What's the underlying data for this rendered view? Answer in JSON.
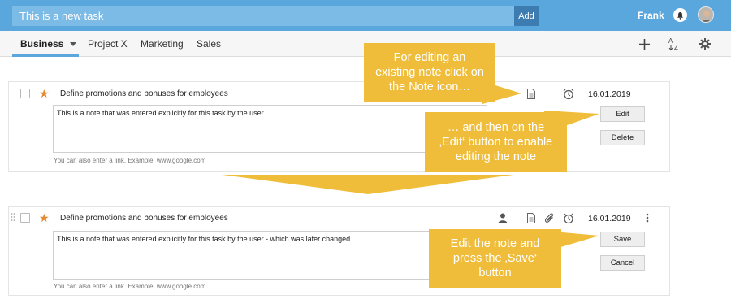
{
  "topbar": {
    "task_input_value": "This is a new task",
    "add_label": "Add",
    "user_name": "Frank"
  },
  "tabs": [
    {
      "label": "Business"
    },
    {
      "label": "Project X"
    },
    {
      "label": "Marketing"
    },
    {
      "label": "Sales"
    }
  ],
  "task_before": {
    "title": "Define promotions and bonuses for employees",
    "date": "16.01.2019",
    "note_text": "This is a note that was entered explicitly for this task by the user.",
    "hint": "You can also enter a link. Example: www.google.com",
    "edit_label": "Edit",
    "delete_label": "Delete"
  },
  "task_after": {
    "title": "Define promotions and bonuses for employees",
    "date": "16.01.2019",
    "note_text": "This is a note that was entered explicitly for this task by the user - which was later changed",
    "hint": "You can also enter a link. Example: www.google.com",
    "save_label": "Save",
    "cancel_label": "Cancel"
  },
  "callouts": {
    "note_icon": "For editing an\nexisting note click on\nthe Note icon…",
    "edit_button": "… and then on the\n‚Edit‘ button to enable\nediting the note",
    "save_button": "Edit the note and\npress the ‚Save‘\nbutton"
  },
  "colors": {
    "topbar": "#5aa7dd",
    "callout": "#f0bd3b",
    "star": "#e4892d",
    "add_button": "#3c7cb0"
  },
  "icons": [
    "bell-icon",
    "avatar",
    "plus-icon",
    "sort-az-icon",
    "gear-icon",
    "star-icon",
    "note-icon",
    "alarm-icon",
    "person-icon",
    "paperclip-icon",
    "more-vertical-icon",
    "drag-handle-icon"
  ]
}
